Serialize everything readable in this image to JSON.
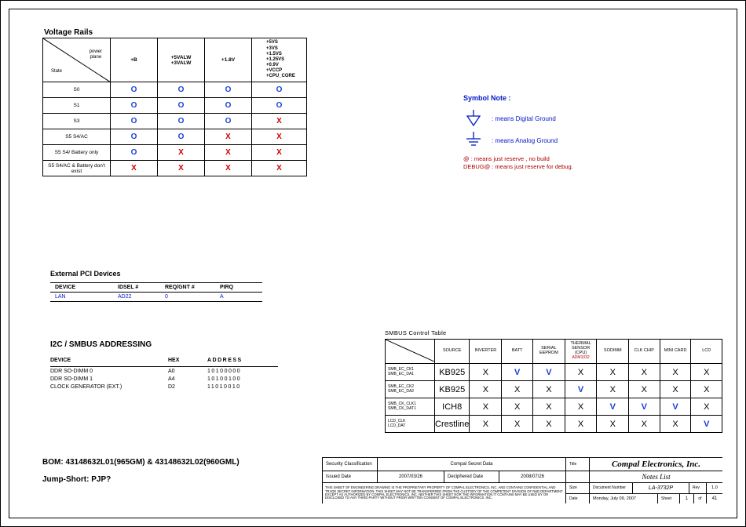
{
  "voltage_rails": {
    "title": "Voltage Rails",
    "corner": {
      "power": "power\nplane",
      "state": "State"
    },
    "col_headers": [
      "+B",
      "+5VALW\n+3VALW",
      "+1.8V"
    ],
    "col5_list": [
      "+5VS",
      "+3VS",
      "+1.5VS",
      "+1.25VS",
      "+0.9V",
      "+VCCP",
      "+CPU_CORE"
    ],
    "rows": [
      {
        "label": "S0",
        "cells": [
          "O",
          "O",
          "O",
          "O"
        ]
      },
      {
        "label": "S1",
        "cells": [
          "O",
          "O",
          "O",
          "O"
        ]
      },
      {
        "label": "S3",
        "cells": [
          "O",
          "O",
          "O",
          "X"
        ]
      },
      {
        "label": "S5 S4/AC",
        "cells": [
          "O",
          "O",
          "X",
          "X"
        ]
      },
      {
        "label": "S5 S4/ Battery only",
        "cells": [
          "O",
          "X",
          "X",
          "X"
        ]
      },
      {
        "label": "S5 S4/AC & Battery don't exist",
        "cells": [
          "X",
          "X",
          "X",
          "X"
        ]
      }
    ]
  },
  "symbol_note": {
    "title": "Symbol Note :",
    "digital": ": means Digital Ground",
    "analog": ": means Analog Ground",
    "reserve": "@ : means just reserve , no build",
    "debug": "DEBUG@ : means just reserve for debug."
  },
  "external_pci": {
    "title": "External PCI Devices",
    "headers": [
      "DEVICE",
      "IDSEL #",
      "REQ/GNT #",
      "PIRQ"
    ],
    "rows": [
      {
        "device": "LAN",
        "idsel": "AD22",
        "reqgnt": "0",
        "pirq": "A"
      }
    ]
  },
  "i2c": {
    "title": "I2C / SMBUS ADDRESSING",
    "headers": [
      "DEVICE",
      "HEX",
      "ADDRESS"
    ],
    "rows": [
      {
        "device": "DDR SO-DIMM 0",
        "hex": "A0",
        "addr": "10100000"
      },
      {
        "device": "DDR SO-DIMM 1",
        "hex": "A4",
        "addr": "10100100"
      },
      {
        "device": "CLOCK GENERATOR (EXT.)",
        "hex": "D2",
        "addr": "11010010"
      }
    ]
  },
  "smbus": {
    "title": "SMBUS Control Table",
    "col_headers": [
      "SOURCE",
      "INVERTER",
      "BATT",
      "SERIAL EEPROM",
      "THERMAL SENSOR (CPU)",
      "SODIMM",
      "CLK CHIP",
      "MINI CARD",
      "LCD"
    ],
    "thermal_sub": "ADM1032",
    "rows": [
      {
        "label": "SMB_EC_CK1\nSMB_EC_DA1",
        "source": "KB925",
        "cells": [
          "X",
          "V",
          "V",
          "X",
          "X",
          "X",
          "X",
          "X"
        ]
      },
      {
        "label": "SMB_EC_CK2\nSMB_EC_DA2",
        "source": "KB925",
        "cells": [
          "X",
          "X",
          "X",
          "V",
          "X",
          "X",
          "X",
          "X"
        ]
      },
      {
        "label": "SMB_CK_CLK1\nSMB_CK_DAT1",
        "source": "ICH8",
        "cells": [
          "X",
          "X",
          "X",
          "X",
          "V",
          "V",
          "V",
          "X"
        ]
      },
      {
        "label": "LCD_CLK\nLCD_DAT",
        "source": "Crestline",
        "cells": [
          "X",
          "X",
          "X",
          "X",
          "X",
          "X",
          "X",
          "V"
        ]
      }
    ]
  },
  "bom": {
    "line": "BOM: 43148632L01(965GM) & 43148632L02(960GML)",
    "jump": "Jump-Short:   PJP?"
  },
  "titleblock": {
    "sec_class_label": "Security Classification",
    "sec_class_value": "Compal Secret Data",
    "issued_label": "Issued Date",
    "issued_value": "2007/03/26",
    "deciphered_label": "Deciphered Date",
    "deciphered_value": "2008/07/26",
    "company": "Compal Electronics, Inc.",
    "title_label": "Title",
    "notes_title": "Notes List",
    "size_label": "Size",
    "docnum_label": "Document Number",
    "docnum_value": "LA-3732P",
    "rev_label": "Rev",
    "rev_value": "1.0",
    "date_label": "Date",
    "date_value": "Monday, July 09, 2007",
    "sheet_label": "Sheet",
    "sheet_cur": "1",
    "sheet_of": "of",
    "sheet_tot": "41",
    "fine_print": "THIS SHEET OF ENGINEERING DRAWING IS THE PROPRIETARY PROPERTY OF COMPAL ELECTRONICS, INC. AND CONTAINS CONFIDENTIAL AND TRADE SECRET INFORMATION. THIS SHEET MAY NOT BE TRANSFERRED FROM THE CUSTODY OF THE COMPETENT DIVISION OF R&D DEPARTMENT EXCEPT AS AUTHORIZED BY COMPAL ELECTRONICS, INC. NEITHER THIS SHEET NOR THE INFORMATION IT CONTAINS MAY BE USED BY OR DISCLOSED TO ANY THIRD PARTY WITHOUT PRIOR WRITTEN CONSENT OF COMPAL ELECTRONICS, INC."
  }
}
